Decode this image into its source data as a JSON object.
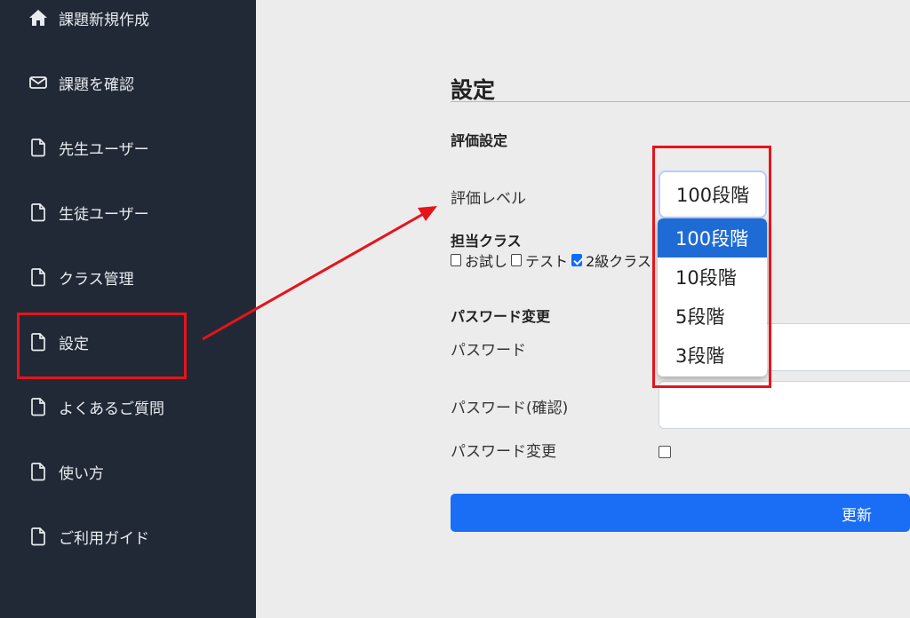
{
  "sidebar": {
    "items": [
      {
        "label": "課題新規作成",
        "icon": "home-icon"
      },
      {
        "label": "課題を確認",
        "icon": "mail-icon"
      },
      {
        "label": "先生ユーザー",
        "icon": "file-icon"
      },
      {
        "label": "生徒ユーザー",
        "icon": "file-icon"
      },
      {
        "label": "クラス管理",
        "icon": "file-icon"
      },
      {
        "label": "設定",
        "icon": "file-icon"
      },
      {
        "label": "よくあるご質問",
        "icon": "file-icon"
      },
      {
        "label": "使い方",
        "icon": "file-icon"
      },
      {
        "label": "ご利用ガイド",
        "icon": "file-icon"
      }
    ]
  },
  "main": {
    "title": "設定",
    "evaluation": {
      "heading": "評価設定",
      "level_label": "評価レベル",
      "selected": "100段階",
      "options": [
        "100段階",
        "10段階",
        "5段階",
        "3段階"
      ]
    },
    "classes": {
      "heading": "担当クラス",
      "items": [
        {
          "label": "お試し",
          "checked": false
        },
        {
          "label": "テスト",
          "checked": false
        },
        {
          "label": "2級クラス",
          "checked": true
        }
      ]
    },
    "password": {
      "heading": "パスワード変更",
      "password_label": "パスワード",
      "confirm_label": "パスワード(確認)",
      "change_label": "パスワード変更"
    },
    "update_button": "更新"
  },
  "colors": {
    "sidebar_bg": "#212936",
    "highlight": "#e5141c",
    "primary": "#1a6ef6",
    "option_selected": "#1f6bd6"
  }
}
